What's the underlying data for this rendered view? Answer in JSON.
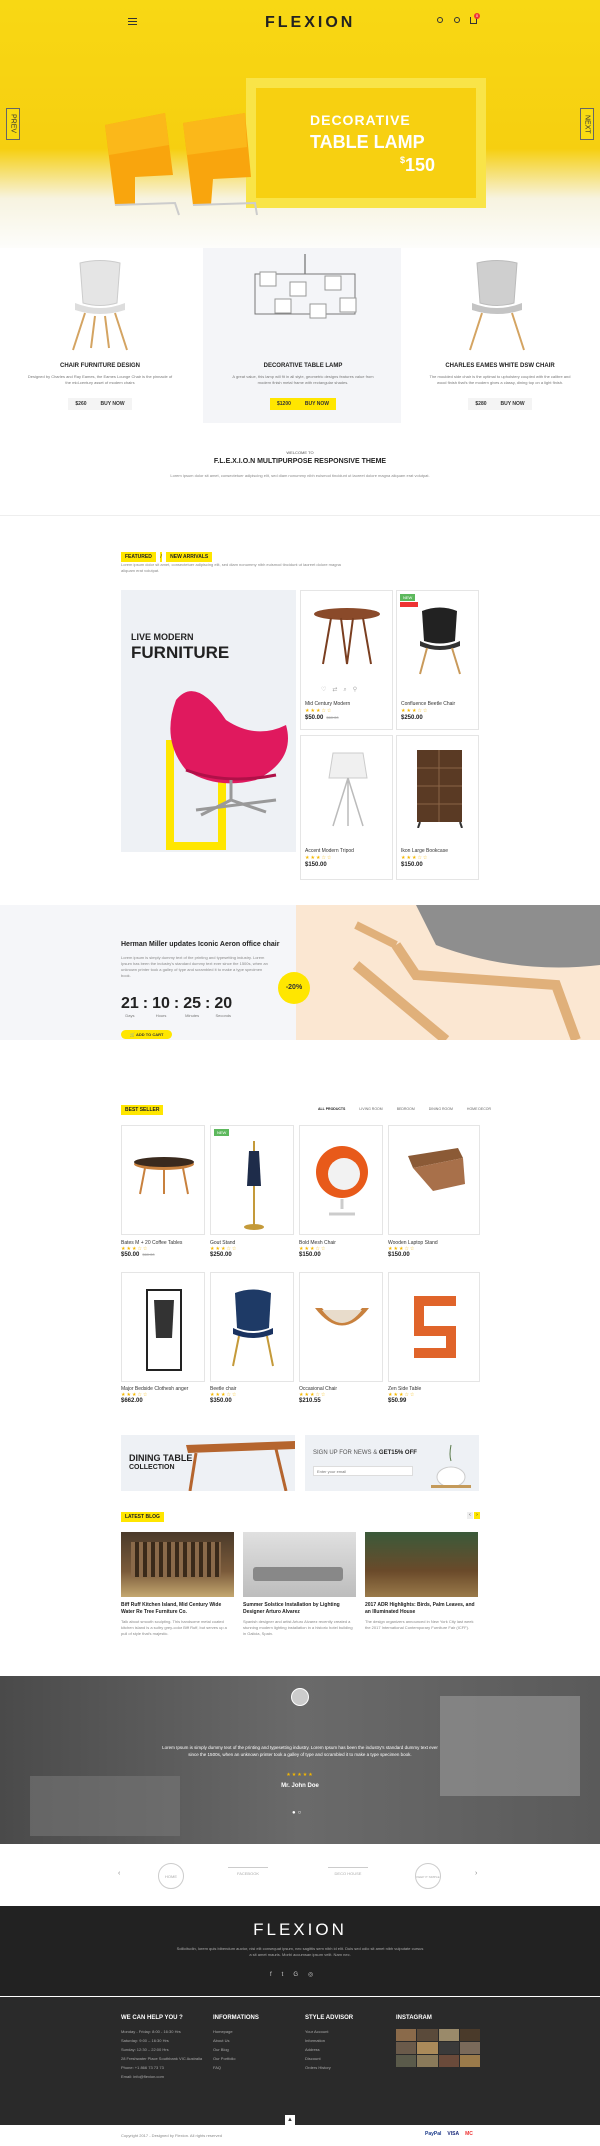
{
  "header": {
    "logo": "FLEXION",
    "menu_icon": "hamburger-icon",
    "search_icon": "search-icon",
    "user_icon": "user-icon",
    "cart_icon": "cart-icon",
    "cart_count": "0"
  },
  "hero": {
    "title": "DECORATIVE",
    "subtitle": "TABLE LAMP",
    "currency": "$",
    "price": "150",
    "prev": "PREV",
    "next": "NEXT"
  },
  "categories": [
    {
      "title": "CHAIR FURNITURE DESIGN",
      "desc": "Designed by Charles and Ray Eames, the Eames Lounge Chair is the pinnacle of the mid-century asset of modern chairs",
      "price": "$260",
      "buy": "BUY NOW"
    },
    {
      "title": "DECORATIVE TABLE LAMP",
      "desc": "A great value, this lamp will fit in all style, geometric designs features value from modern finish metal frame with rectangular shades.",
      "price": "$1200",
      "buy": "BUY NOW"
    },
    {
      "title": "CHARLES EAMES WHITE DSW CHAIR",
      "desc": "The moulded side chair is the optimal to upholstery coupled with the calibre and wood finish that's the modern gives a classy, dining top on a light finish.",
      "price": "$280",
      "buy": "BUY NOW"
    }
  ],
  "welcome": {
    "kicker": "WELCOME TO",
    "title": "F.L.E.X.I.O.N MULTIPURPOSE RESPONSIVE THEME",
    "text": "Lorem ipsum dolor sit amet, consectetuer adipiscing elit, sed diam nonummy nibh euismod tincidunt ut laoreet dolore magna aliquam erat volutpat."
  },
  "featured": {
    "tab1": "FEATURED",
    "sep": "/",
    "tab2": "NEW ARRIVALS",
    "text": "Lorem ipsum dolor sit amet, consectetuer adipiscing elit, sed diam nonummy nibh euismod tincidunt ut laoreet dolore magna aliquam erat volutpat.",
    "banner_line1": "LIVE MODERN",
    "banner_line2": "FURNITURE"
  },
  "featured_products": [
    {
      "name": "Mid Century Modern",
      "stars": "★★★☆☆",
      "price": "$50.00",
      "old": "$60.00",
      "badge": ""
    },
    {
      "name": "Confluence Beetle Chair",
      "stars": "★★★☆☆",
      "price": "$250.00",
      "old": "",
      "badge": "NEW"
    },
    {
      "name": "Accent Modern Tripod",
      "stars": "★★★☆☆",
      "price": "$150.00",
      "old": "",
      "badge": ""
    },
    {
      "name": "Ikon Large Bookcase",
      "stars": "★★★☆☆",
      "price": "$150.00",
      "old": "",
      "badge": ""
    }
  ],
  "deal": {
    "title": "Herman Miller updates Iconic Aeron office chair",
    "text": "Lorem ipsum is simply dummy text of the printing and typesetting industry. Lorem Ipsum has been the industry's standard dummy text ever since the 1500s, when an unknown printer took a galley of type and scrambled it to make a type specimen book.",
    "days": "21",
    "hours": "10",
    "minutes": "25",
    "seconds": "20",
    "days_l": "Days",
    "hours_l": "Hours",
    "minutes_l": "Minutes",
    "seconds_l": "Seconds",
    "cart": "ADD TO CART",
    "discount": "-20%"
  },
  "bestseller": {
    "tag": "BEST SELLER",
    "tabs": [
      "ALL PRODUCTS",
      "LIVING ROOM",
      "BEDROOM",
      "DINING ROOM",
      "HOME DECOR"
    ]
  },
  "best_products": [
    {
      "name": "Bates M + 20 Coffee Tables",
      "stars": "★★★☆☆",
      "price": "$50.00",
      "old": "$60.00",
      "badge": ""
    },
    {
      "name": "Gout Stand",
      "stars": "★★★☆☆",
      "price": "$250.00",
      "old": "",
      "badge": "NEW"
    },
    {
      "name": "Bold Mesh Chair",
      "stars": "★★★☆☆",
      "price": "$150.00",
      "old": "",
      "badge": ""
    },
    {
      "name": "Wooden Laptop Stand",
      "stars": "★★★☆☆",
      "price": "$150.00",
      "old": "",
      "badge": ""
    },
    {
      "name": "Major Bedside Clothesh anger",
      "stars": "★★★☆☆",
      "price": "$662.00",
      "old": "",
      "badge": ""
    },
    {
      "name": "Beetle chair",
      "stars": "★★★☆☆",
      "price": "$350.00",
      "old": "",
      "badge": ""
    },
    {
      "name": "Occasional Chair",
      "stars": "★★★☆☆",
      "price": "$210.55",
      "old": "",
      "badge": ""
    },
    {
      "name": "Zen Side Table",
      "stars": "★★★☆☆",
      "price": "$50.99",
      "old": "",
      "badge": ""
    }
  ],
  "promo": {
    "line1": "DINING TABLE",
    "line2": "COLLECTION",
    "news_a": "SIGN UP FOR NEWS & ",
    "news_b": "GET15% OFF",
    "placeholder": "Enter your email"
  },
  "blog": {
    "tag": "LATEST BLOG",
    "posts": [
      {
        "title": "Biff Ruff Kitchen Island, Mid Century Wide Water Re Tree Furniture Co.",
        "text": "Talk about smooth sculpting. This handsome metal coated kitchen island is a sultry grey-color Biff Ruff, but serves up a pull of style that's majestic."
      },
      {
        "title": "Summer Solstice Installation by Lighting Designer Arturo Alvarez",
        "text": "Spanish designer and artist Arturo Alvarez recently created a stunning modern lighting installation in a historic hotel building in Galicia, Spain."
      },
      {
        "title": "2017 ADR Highlights: Birds, Palm Leaves, and an Illuminated House",
        "text": "The design organizers announced in New York City last week the 2017 International Contemporary Furniture Fair (ICFF)."
      }
    ]
  },
  "testimonial": {
    "text": "Lorem Ipsum is simply dummy text of the printing and typesetting industry. Lorem Ipsum has been the industry's standard dummy text ever since the 1500s, when an unknown printer took a galley of type and scrambled it to make a type specimen book.",
    "stars": "★★★★★",
    "name": "Mr. John Doe"
  },
  "brands": [
    "HOME",
    "FACEBOOK",
    "DECO HOUSE",
    "KEEP IT SIMPLE"
  ],
  "footer_top": {
    "logo": "FLEXION",
    "text": "Sollicitudin, lorem quis bibendum auctor, nisi elit consequat ipsum, nec sagittis sem nibh id elit. Duis sed odio sit amet nibh vulputate cursus a sit amet mauris. Morbi accumsan ipsum velit. Nam nec."
  },
  "footer": {
    "help": {
      "title": "WE CAN HELP YOU ?",
      "lines": [
        "Monday - Friday: 8:00 - 16:30 Hrs",
        "Saturday: 9:00 – 16:30 Hrs",
        "Sunday: 12:30 – 22:00 Hrs",
        "28 Freshwater Place Southbank VIC Australia",
        "Phone: +1 866 73 73 73",
        "Email: info@flexion.com"
      ]
    },
    "info": {
      "title": "INFORMATIONS",
      "lines": [
        "Homepage",
        "About Us",
        "Our Blog",
        "Our Portfolio",
        "FAQ"
      ]
    },
    "style": {
      "title": "STYLE ADVISOR",
      "lines": [
        "Your Account",
        "Information",
        "Address",
        "Discount",
        "Orders History"
      ]
    },
    "insta": {
      "title": "INSTAGRAM"
    }
  },
  "copyright": "Copyright 2017 - Designed by Flexion. All rights reserved",
  "payments": [
    "PayPal",
    "VISA",
    "MC"
  ]
}
